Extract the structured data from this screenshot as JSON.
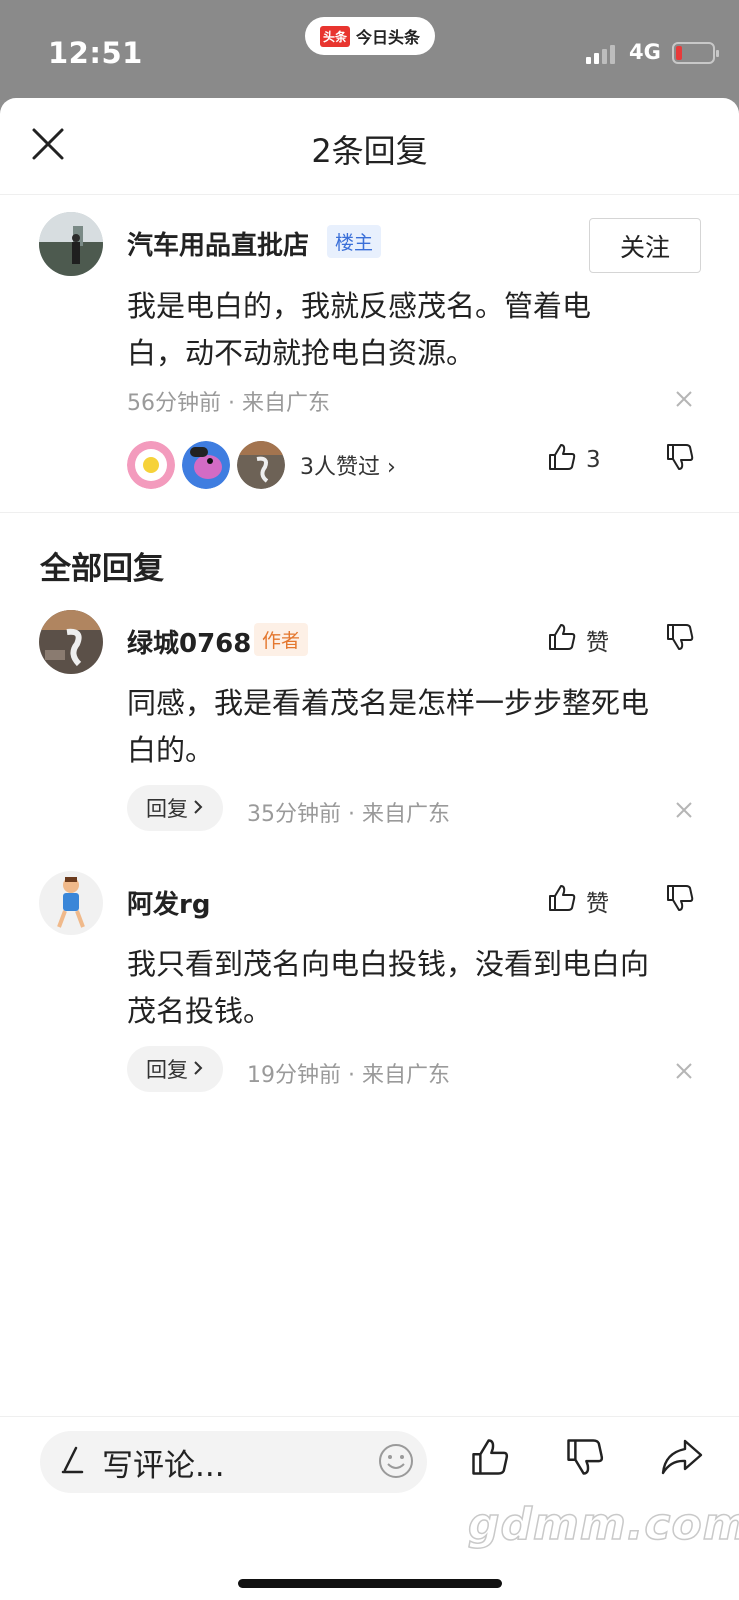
{
  "status_bar": {
    "time": "12:51",
    "app_logo": "头条",
    "app_name": "今日头条",
    "network": "4G",
    "battery_level": 0.12
  },
  "sheet": {
    "title": "2条回复",
    "close_icon": "close-icon"
  },
  "main_comment": {
    "username": "汽车用品直批店",
    "badge": "楼主",
    "follow_label": "关注",
    "content_line1": "我是电白的，我就反感茂名。管着电",
    "content_line2": "白，动不动就抢电白资源。",
    "meta": "56分钟前 · 来自广东",
    "likers_text": "3人赞过 ›",
    "like_count": "3"
  },
  "replies_section": {
    "title": "全部回复"
  },
  "replies": [
    {
      "username": "绿城0768",
      "badge": "作者",
      "like_label": "赞",
      "content_line1": "同感，我是看着茂名是怎样一步步整死电",
      "content_line2": "白的。",
      "reply_label": "回复",
      "meta": "35分钟前 · 来自广东"
    },
    {
      "username": "阿发rg",
      "like_label": "赞",
      "content_line1": "我只看到茂名向电白投钱，没看到电白向",
      "content_line2": "茂名投钱。",
      "reply_label": "回复",
      "meta": "19分钟前 · 来自广东"
    }
  ],
  "bottom_bar": {
    "comment_placeholder": "写评论...",
    "watermark": "gdmm.com"
  },
  "colors": {
    "accent_red": "#e8352f",
    "owner_tag": "#3a6fd8",
    "author_tag": "#e4772e"
  }
}
